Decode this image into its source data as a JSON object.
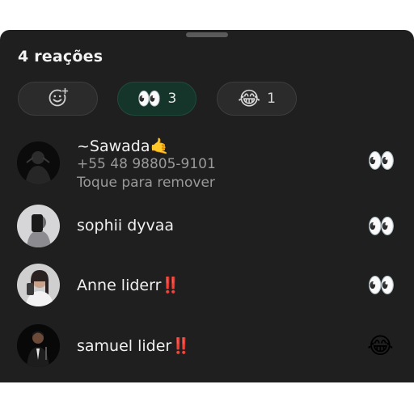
{
  "header": {
    "title": "4 reações"
  },
  "filters": {
    "add_reaction_icon": "smiley-add-icon",
    "chips": [
      {
        "emoji": "👀",
        "count": "3",
        "selected": true
      },
      {
        "emoji": "😂",
        "count": "1",
        "selected": false
      }
    ]
  },
  "reactions": [
    {
      "name": "~Sawada🤙",
      "phone": "+55 48 98805-9101",
      "hint": "Toque para remover",
      "emoji": "👀"
    },
    {
      "name": "sophii dyvaa",
      "emoji": "👀"
    },
    {
      "name": "Anne liderr‼️",
      "emoji": "👀"
    },
    {
      "name": "samuel lider‼️",
      "emoji": "😂"
    }
  ],
  "colors": {
    "sheet_background": "#1f1f1f",
    "chip_background": "#2b2b2b",
    "selected_chip_background": "#16352a",
    "primary_text": "#f0f0f0",
    "secondary_text": "#9a9a9a"
  }
}
